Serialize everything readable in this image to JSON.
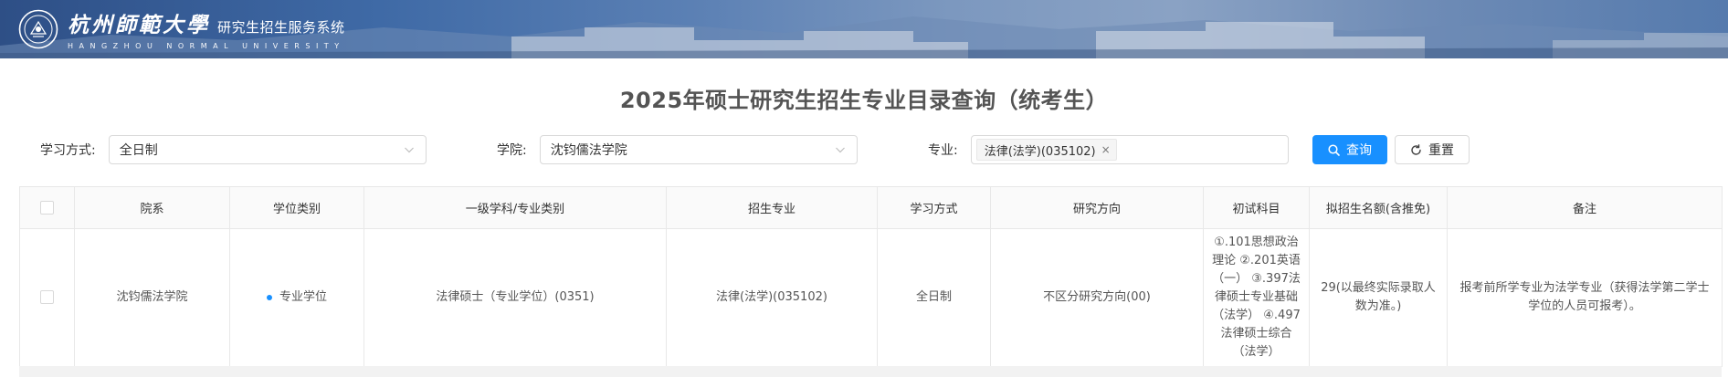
{
  "header": {
    "university_cn": "杭州師範大學",
    "system_name": "研究生招生服务系统",
    "university_en": "HANGZHOU NORMAL UNIVERSITY"
  },
  "page_title": "2025年硕士研究生招生专业目录查询（统考生）",
  "filters": {
    "study_mode": {
      "label": "学习方式:",
      "value": "全日制"
    },
    "college": {
      "label": "学院:",
      "value": "沈钧儒法学院"
    },
    "major": {
      "label": "专业:",
      "tag": "法律(法学)(035102)",
      "tag_close": "×"
    }
  },
  "buttons": {
    "search": "查询",
    "reset": "重置"
  },
  "table": {
    "headers": [
      "院系",
      "学位类别",
      "一级学科/专业类别",
      "招生专业",
      "学习方式",
      "研究方向",
      "初试科目",
      "拟招生名额(含推免)",
      "备注"
    ],
    "rows": [
      {
        "department": "沈钧儒法学院",
        "degree_type": "专业学位",
        "discipline": "法律硕士（专业学位）(0351)",
        "major": "法律(法学)(035102)",
        "study_mode": "全日制",
        "research_direction": "不区分研究方向(00)",
        "exam_subjects": "①.101思想政治理论 ②.201英语（一） ③.397法律硕士专业基础（法学） ④.497法律硕士综合（法学）",
        "quota": "29(以最终实际录取人数为准。)",
        "remarks": "报考前所学专业为法学专业（获得法学第二学士学位的人员可报考）。"
      }
    ]
  },
  "colors": {
    "primary": "#1890ff",
    "banner": "#3f6aa6",
    "title": "#545454"
  }
}
